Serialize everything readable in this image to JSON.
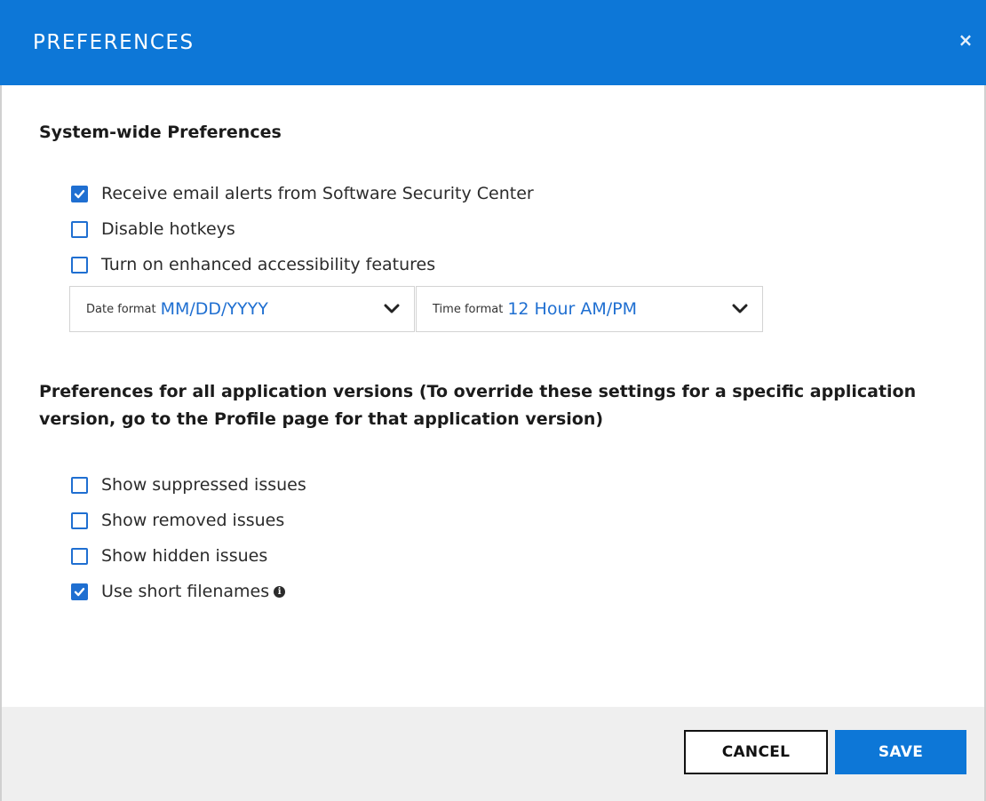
{
  "dialog": {
    "title": "PREFERENCES",
    "close_glyph": "×"
  },
  "system": {
    "title": "System-wide Preferences",
    "options": [
      {
        "label": "Receive email alerts from Software Security Center",
        "checked": true
      },
      {
        "label": "Disable hotkeys",
        "checked": false
      },
      {
        "label": "Turn on enhanced accessibility features",
        "checked": false
      }
    ],
    "date_format": {
      "label": "Date format",
      "value": "MM/DD/YYYY"
    },
    "time_format": {
      "label": "Time format",
      "value": "12 Hour AM/PM"
    }
  },
  "app_versions": {
    "title": "Preferences for all application versions (To override these settings for a specific application version, go to the Profile page for that application version)",
    "options": [
      {
        "label": "Show suppressed issues",
        "checked": false
      },
      {
        "label": "Show removed issues",
        "checked": false
      },
      {
        "label": "Show hidden issues",
        "checked": false
      },
      {
        "label": "Use short filenames",
        "checked": true
      }
    ]
  },
  "footer": {
    "cancel_label": "CANCEL",
    "save_label": "SAVE"
  },
  "colors": {
    "accent": "#0d77d7",
    "checkbox": "#1f6fd1",
    "footer_bg": "#efefef"
  },
  "icons": {
    "close": "close-icon",
    "check": "checkmark-icon",
    "chevron": "chevron-down-icon",
    "info": "info-icon"
  }
}
